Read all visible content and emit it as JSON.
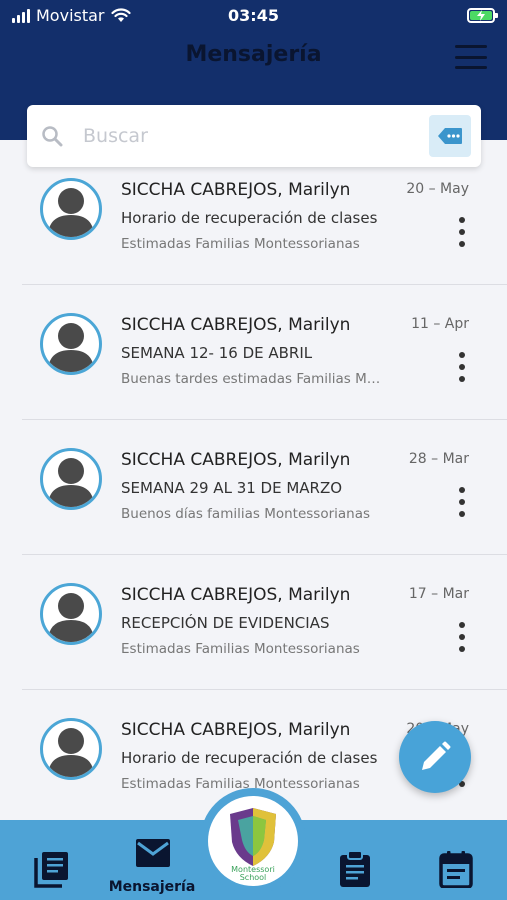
{
  "status_bar": {
    "carrier": "Movistar",
    "time": "03:45"
  },
  "header": {
    "title": "Mensajería"
  },
  "search": {
    "placeholder": "Buscar"
  },
  "messages": [
    {
      "sender": "SICCHA CABREJOS, Marilyn",
      "subject": "Horario de recuperación de clases",
      "preview": "Estimadas Familias Montessorianas",
      "date": "20 – May"
    },
    {
      "sender": "SICCHA CABREJOS, Marilyn",
      "subject": "SEMANA 12- 16 DE ABRIL",
      "preview": "Buenas tardes estimadas Familias Montessorianas",
      "date": "11 – Apr"
    },
    {
      "sender": "SICCHA CABREJOS, Marilyn",
      "subject": "SEMANA 29 AL 31 DE MARZO",
      "preview": "Buenos días familias Montessorianas",
      "date": "28 – Mar"
    },
    {
      "sender": "SICCHA CABREJOS, Marilyn",
      "subject": "RECEPCIÓN DE EVIDENCIAS",
      "preview": "Estimadas Familias Montessorianas",
      "date": "17 – Mar"
    },
    {
      "sender": "SICCHA CABREJOS, Marilyn",
      "subject": "Horario de recuperación de clases",
      "preview": "Estimadas Familias Montessorianas",
      "date": "20 – May"
    }
  ],
  "tabbar": {
    "tabs": [
      {
        "icon": "book-icon",
        "label": ""
      },
      {
        "icon": "envelope-icon",
        "label": "Mensajería"
      },
      {
        "icon": "school-logo",
        "label": "",
        "logo_text": "Montessori School"
      },
      {
        "icon": "clipboard-icon",
        "label": ""
      },
      {
        "icon": "calendar-icon",
        "label": ""
      }
    ]
  },
  "colors": {
    "header": "#132f6b",
    "accent": "#4ea3d6",
    "fab": "#48a3d8",
    "avatar_ring": "#4ba6d6"
  }
}
